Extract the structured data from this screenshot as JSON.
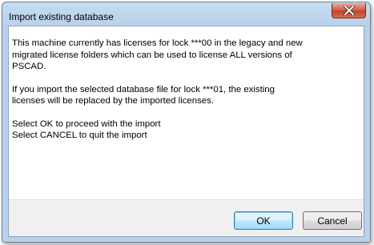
{
  "window": {
    "title": "Import existing database"
  },
  "message": {
    "paragraph1": "This machine currently has licenses for lock  ***00  in the legacy and new\nmigrated license folders which can be used to license ALL versions of\nPSCAD.",
    "paragraph2": "If you import the selected database file for lock ***01, the existing\nlicenses will be replaced by the imported licenses.",
    "paragraph3": "Select OK to proceed with the import\nSelect CANCEL to quit the import"
  },
  "buttons": {
    "ok_label": "OK",
    "cancel_label": "Cancel"
  },
  "icons": {
    "close": "close-x-icon"
  },
  "colors": {
    "close_button": "#c2432d",
    "title_bar": "#b9d1ea",
    "footer": "#f0f0f0"
  }
}
